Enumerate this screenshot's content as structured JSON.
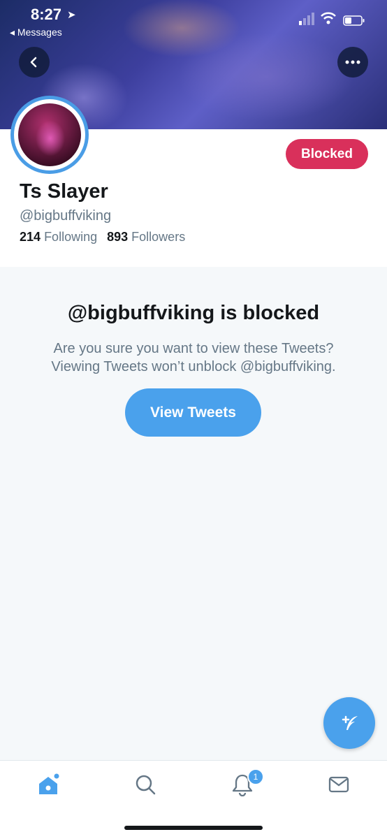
{
  "status_bar": {
    "time": "8:27",
    "back_app": "◂ Messages"
  },
  "profile": {
    "display_name": "Ts Slayer",
    "handle": "@bigbuffviking",
    "following_count": "214",
    "following_label": "Following",
    "followers_count": "893",
    "followers_label": "Followers",
    "blocked_label": "Blocked"
  },
  "blocked_notice": {
    "title": "@bigbuffviking is blocked",
    "line1": "Are you sure you want to view these Tweets?",
    "line2": "Viewing Tweets won’t unblock @bigbuffviking.",
    "button": "View Tweets"
  },
  "tab_bar": {
    "tabs": [
      "home-icon",
      "search-icon",
      "notifications-icon",
      "messages-icon"
    ],
    "notification_badge": "1"
  },
  "colors": {
    "accent": "#4aa1ec",
    "blocked": "#d9305b",
    "text_primary": "#14171a",
    "text_secondary": "#657786"
  }
}
